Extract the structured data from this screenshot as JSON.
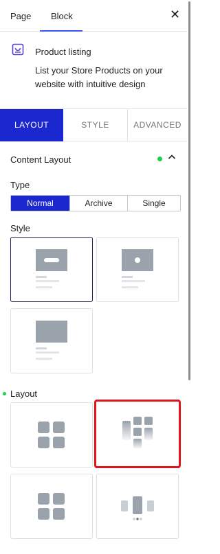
{
  "header": {
    "tabs": [
      {
        "label": "Page",
        "active": false
      },
      {
        "label": "Block",
        "active": true
      }
    ],
    "close_icon": "close-icon",
    "accent_color": "#3858e9"
  },
  "block": {
    "icon": "product-listing-icon",
    "name": "Product listing",
    "description": "List your Store Products on your website with intuitive design"
  },
  "panel_tabs": [
    {
      "label": "LAYOUT",
      "active": true
    },
    {
      "label": "STYLE",
      "active": false
    },
    {
      "label": "ADVANCED",
      "active": false
    }
  ],
  "panel_tab_active_color": "#1b28d0",
  "content_layout": {
    "title": "Content Layout",
    "indicator_color": "#1ed14b",
    "expanded": true,
    "type": {
      "label": "Type",
      "options": [
        "Normal",
        "Archive",
        "Single"
      ],
      "selected": "Normal"
    },
    "style": {
      "label": "Style",
      "options": [
        "style-button-overlay",
        "style-dot-overlay",
        "style-plain"
      ],
      "selected": "style-button-overlay"
    },
    "layout": {
      "label": "Layout",
      "options": [
        "layout-grid",
        "layout-masonry",
        "layout-grid-alt",
        "layout-slider"
      ],
      "highlighted": "layout-masonry"
    }
  }
}
